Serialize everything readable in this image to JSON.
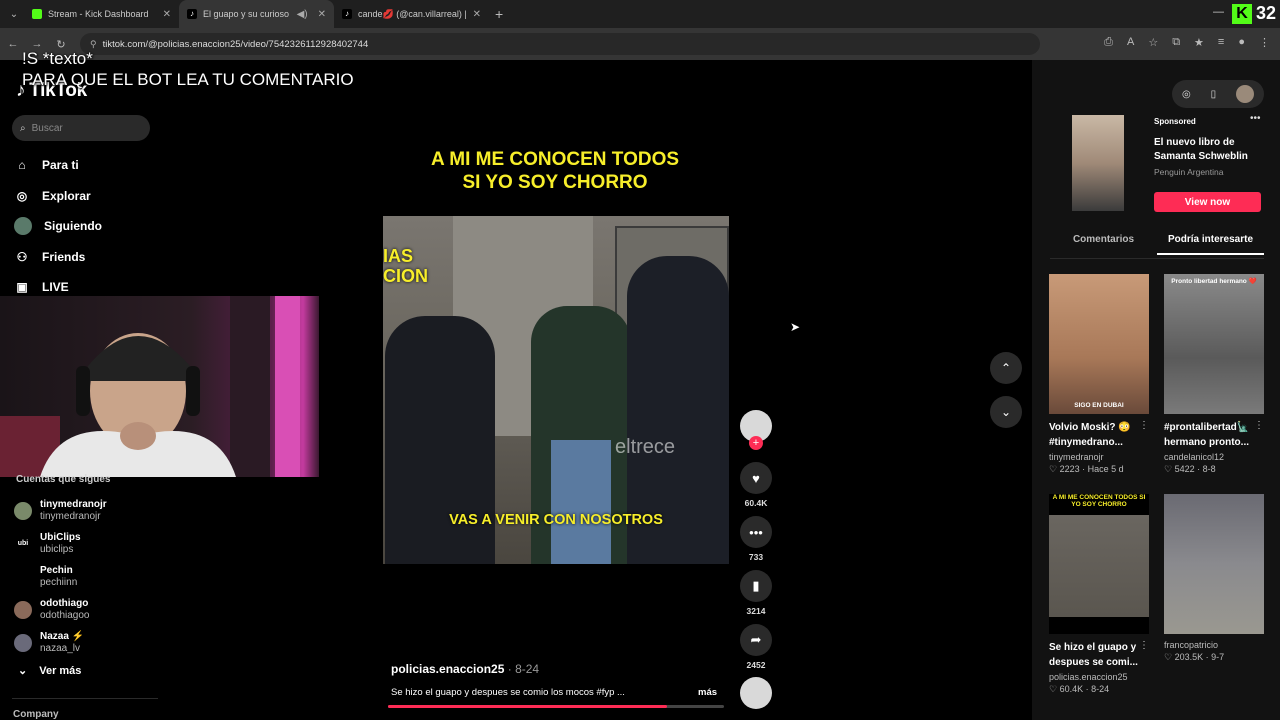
{
  "browser": {
    "tabs": [
      {
        "title": "Stream - Kick Dashboard",
        "favicon_color": "#53fc18",
        "active": false
      },
      {
        "title": "El guapo y su curioso comp",
        "favicon_color": "#ffffff",
        "active": true
      },
      {
        "title": "cande💋 (@can.villarreal) | TikT",
        "favicon_color": "#ffffff",
        "active": false
      }
    ],
    "url": "tiktok.com/@policias.enaccion25/video/7542326112928402744",
    "kick_count": "32"
  },
  "overlay": {
    "line1": "!S *texto*",
    "line2": "PARA  QUE EL BOT LEA TU COMENTARIO"
  },
  "sidebar": {
    "logo": "TikTok",
    "search_placeholder": "Buscar",
    "nav": [
      {
        "label": "Para ti",
        "icon": "home-icon"
      },
      {
        "label": "Explorar",
        "icon": "compass-icon"
      },
      {
        "label": "Siguiendo",
        "icon": "following-icon"
      },
      {
        "label": "Friends",
        "icon": "friends-icon"
      },
      {
        "label": "LIVE",
        "icon": "live-icon"
      }
    ],
    "following_title": "Cuentas que sigues",
    "following": [
      {
        "name": "tinymedranojr",
        "handle": "tinymedranojr"
      },
      {
        "name": "UbiClips",
        "handle": "ubiclips"
      },
      {
        "name": "Pechin",
        "handle": "pechiinn"
      },
      {
        "name": "odothiago",
        "handle": "odothiagoo"
      },
      {
        "name": "Nazaa ⚡",
        "handle": "nazaa_lv"
      }
    ],
    "ver_mas": "Ver más",
    "company": "Company"
  },
  "video": {
    "caption_line1": "A MI ME CONOCEN TODOS",
    "caption_line2": "SI YO SOY CHORRO",
    "subtitle": "VAS A VENIR CON NOSOTROS",
    "watermark": "eltrece",
    "topleft_text1": "IAS",
    "topleft_text2": "CION",
    "author": "policias.enaccion25",
    "date": "· 8-24",
    "description": "Se hizo el guapo y despues se comio los mocos #fyp ...",
    "more": "más",
    "progress": 0.83,
    "likes": "60.4K",
    "comments": "733",
    "saves": "3214",
    "shares": "2452"
  },
  "right": {
    "ad": {
      "sponsored": "Sponsored",
      "title": "El nuevo libro de Samanta Schweblin",
      "publisher": "Penguin Argentina",
      "button": "View now"
    },
    "tabs": [
      "Comentarios",
      "Podría interesarte"
    ],
    "videos": [
      {
        "title": "Volvio Moski? 😳 #tinymedrano...",
        "author": "tinymedranojr",
        "stats": "♡ 2223 · Hace 5 d",
        "thumb_label": "SIGO EN DUBAI"
      },
      {
        "title": "#prontalibertad🗽 hermano pronto...",
        "author": "candelanicol12",
        "stats": "♡ 5422 · 8-8",
        "thumb_label": "Pronto libertad hermano ❤️"
      },
      {
        "title": "Se hizo el guapo y despues se comi...",
        "author": "policias.enaccion25",
        "stats": "♡ 60.4K · 8-24",
        "thumb_label": "A MI ME CONOCEN TODOS SI YO SOY CHORRO"
      },
      {
        "title": "",
        "author": "francopatricio",
        "stats": "♡ 203.5K · 9-7",
        "thumb_label": ""
      }
    ]
  }
}
